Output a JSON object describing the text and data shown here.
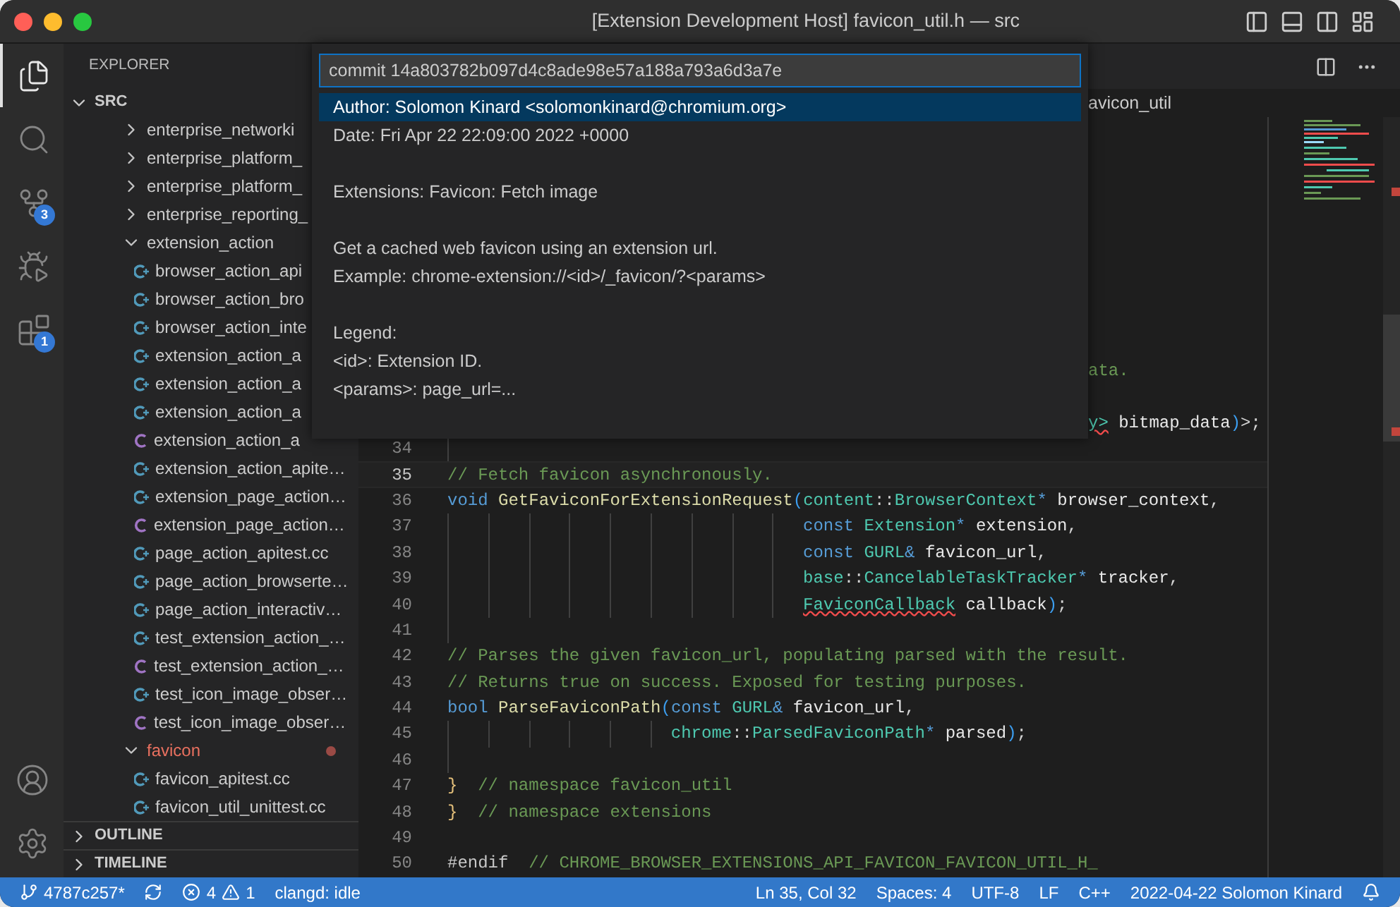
{
  "window": {
    "title": "[Extension Development Host] favicon_util.h — src"
  },
  "activity_bar": {
    "items": [
      {
        "kind": "explorer",
        "selected": true
      },
      {
        "kind": "search",
        "selected": false
      },
      {
        "kind": "source_control",
        "selected": false,
        "badge": "3"
      },
      {
        "kind": "run_debug",
        "selected": false
      },
      {
        "kind": "extensions",
        "selected": false,
        "badge": "1"
      }
    ],
    "bottom": [
      {
        "kind": "account"
      },
      {
        "kind": "settings"
      }
    ]
  },
  "sidebar": {
    "title": "EXPLORER",
    "root": {
      "label": "SRC",
      "expanded": true,
      "children": [
        {
          "label": "enterprise_networki",
          "kind": "folder",
          "expanded": false,
          "has_problems": false
        },
        {
          "label": "enterprise_platform_",
          "kind": "folder",
          "expanded": false,
          "has_problems": false
        },
        {
          "label": "enterprise_platform_",
          "kind": "folder",
          "expanded": false,
          "has_problems": false
        },
        {
          "label": "enterprise_reporting_",
          "kind": "folder",
          "expanded": false,
          "has_problems": false
        },
        {
          "label": "extension_action",
          "kind": "folder",
          "expanded": true,
          "has_problems": false,
          "children": [
            {
              "label": "browser_action_api",
              "kind": "source"
            },
            {
              "label": "browser_action_bro",
              "kind": "source"
            },
            {
              "label": "browser_action_inte",
              "kind": "source"
            },
            {
              "label": "extension_action_a",
              "kind": "source"
            },
            {
              "label": "extension_action_a",
              "kind": "source"
            },
            {
              "label": "extension_action_a",
              "kind": "source"
            },
            {
              "label": "extension_action_a",
              "kind": "header"
            },
            {
              "label": "extension_action_apite…",
              "kind": "source"
            },
            {
              "label": "extension_page_action…",
              "kind": "source"
            },
            {
              "label": "extension_page_action…",
              "kind": "header"
            },
            {
              "label": "page_action_apitest.cc",
              "kind": "source"
            },
            {
              "label": "page_action_browserte…",
              "kind": "source"
            },
            {
              "label": "page_action_interactiv…",
              "kind": "source"
            },
            {
              "label": "test_extension_action_…",
              "kind": "source"
            },
            {
              "label": "test_extension_action_…",
              "kind": "header"
            },
            {
              "label": "test_icon_image_obser…",
              "kind": "source"
            },
            {
              "label": "test_icon_image_obser…",
              "kind": "header"
            }
          ]
        },
        {
          "label": "favicon",
          "kind": "folder",
          "expanded": true,
          "has_problems": true,
          "children": [
            {
              "label": "favicon_apitest.cc",
              "kind": "source"
            },
            {
              "label": "favicon_util_unittest.cc",
              "kind": "source"
            }
          ]
        }
      ]
    },
    "sections": [
      {
        "label": "OUTLINE",
        "expanded": false
      },
      {
        "label": "TIMELINE",
        "expanded": false
      }
    ]
  },
  "editor": {
    "breadcrumb": "avicon_util",
    "covered_fragments": [
      {
        "tokens": [
          {
            "t": "ata.",
            "kind": "comment"
          }
        ]
      },
      {
        "tokens": [
          {
            "t": "y>",
            "kind": "type",
            "error": true
          },
          {
            "t": " bitmap_data",
            "kind": "param"
          },
          {
            "t": ")",
            "kind": "bracket"
          },
          {
            "t": ">;",
            "kind": "plain"
          }
        ]
      }
    ],
    "lines": [
      {
        "number": "34",
        "kind": "blank",
        "current": false
      },
      {
        "number": "35",
        "kind": "code",
        "current": true,
        "tokens": [
          {
            "t": "// Fetch favicon asynchronously.",
            "kind": "comment"
          }
        ]
      },
      {
        "number": "36",
        "kind": "code",
        "current": false,
        "tokens": [
          {
            "t": "void ",
            "kind": "keyword"
          },
          {
            "t": "GetFaviconForExtensionRequest",
            "kind": "function"
          },
          {
            "t": "(",
            "kind": "bracket"
          },
          {
            "t": "content",
            "kind": "type"
          },
          {
            "t": "::",
            "kind": "plain"
          },
          {
            "t": "BrowserContext",
            "kind": "type"
          },
          {
            "t": "* ",
            "kind": "keyword"
          },
          {
            "t": "browser_context",
            "kind": "param"
          },
          {
            "t": ",",
            "kind": "plain"
          }
        ]
      },
      {
        "number": "37",
        "kind": "continuation",
        "current": false,
        "tokens": [
          {
            "t": "const ",
            "kind": "keyword"
          },
          {
            "t": "Extension",
            "kind": "type"
          },
          {
            "t": "* ",
            "kind": "keyword"
          },
          {
            "t": "extension",
            "kind": "param"
          },
          {
            "t": ",",
            "kind": "plain"
          }
        ]
      },
      {
        "number": "38",
        "kind": "continuation",
        "current": false,
        "tokens": [
          {
            "t": "const ",
            "kind": "keyword"
          },
          {
            "t": "GURL",
            "kind": "type"
          },
          {
            "t": "& ",
            "kind": "keyword"
          },
          {
            "t": "favicon_url",
            "kind": "param"
          },
          {
            "t": ",",
            "kind": "plain"
          }
        ]
      },
      {
        "number": "39",
        "kind": "continuation",
        "current": false,
        "tokens": [
          {
            "t": "base",
            "kind": "type"
          },
          {
            "t": "::",
            "kind": "plain"
          },
          {
            "t": "CancelableTaskTracker",
            "kind": "type"
          },
          {
            "t": "* ",
            "kind": "keyword"
          },
          {
            "t": "tracker",
            "kind": "param"
          },
          {
            "t": ",",
            "kind": "plain"
          }
        ]
      },
      {
        "number": "40",
        "kind": "continuation",
        "current": false,
        "tokens": [
          {
            "t": "FaviconCallback",
            "kind": "type",
            "error": true
          },
          {
            "t": " callback",
            "kind": "param"
          },
          {
            "t": ")",
            "kind": "bracket"
          },
          {
            "t": ";",
            "kind": "plain"
          }
        ]
      },
      {
        "number": "41",
        "kind": "blank",
        "current": false
      },
      {
        "number": "42",
        "kind": "code",
        "current": false,
        "tokens": [
          {
            "t": "// Parses the given favicon_url, populating parsed with the result.",
            "kind": "comment"
          }
        ]
      },
      {
        "number": "43",
        "kind": "code",
        "current": false,
        "tokens": [
          {
            "t": "// Returns true on success. Exposed for testing purposes.",
            "kind": "comment"
          }
        ]
      },
      {
        "number": "44",
        "kind": "code",
        "current": false,
        "tokens": [
          {
            "t": "bool ",
            "kind": "keyword"
          },
          {
            "t": "ParseFaviconPath",
            "kind": "function"
          },
          {
            "t": "(",
            "kind": "bracket"
          },
          {
            "t": "const ",
            "kind": "keyword"
          },
          {
            "t": "GURL",
            "kind": "type"
          },
          {
            "t": "& ",
            "kind": "keyword"
          },
          {
            "t": "favicon_url",
            "kind": "param"
          },
          {
            "t": ",",
            "kind": "plain"
          }
        ]
      },
      {
        "number": "45",
        "kind": "continuation",
        "current": false,
        "tokens": [
          {
            "t": "chrome",
            "kind": "type"
          },
          {
            "t": "::",
            "kind": "plain"
          },
          {
            "t": "ParsedFaviconPath",
            "kind": "type"
          },
          {
            "t": "* ",
            "kind": "keyword"
          },
          {
            "t": "parsed",
            "kind": "param"
          },
          {
            "t": ")",
            "kind": "bracket"
          },
          {
            "t": ";",
            "kind": "plain"
          }
        ]
      },
      {
        "number": "46",
        "kind": "blank",
        "current": false
      },
      {
        "number": "47",
        "kind": "code",
        "current": false,
        "tokens": [
          {
            "t": "}  ",
            "kind": "brace"
          },
          {
            "t": "// namespace favicon_util",
            "kind": "comment"
          }
        ]
      },
      {
        "number": "48",
        "kind": "code",
        "current": false,
        "tokens": [
          {
            "t": "}  ",
            "kind": "brace"
          },
          {
            "t": "// namespace extensions",
            "kind": "comment"
          }
        ]
      },
      {
        "number": "49",
        "kind": "empty",
        "current": false
      },
      {
        "number": "50",
        "kind": "code",
        "current": false,
        "tokens": [
          {
            "t": "#endif  ",
            "kind": "macro"
          },
          {
            "t": "// CHROME_BROWSER_EXTENSIONS_API_FAVICON_FAVICON_UTIL_H_",
            "kind": "comment"
          }
        ]
      }
    ]
  },
  "quick_pick": {
    "value": "commit 14a803782b097d4c8ade98e57a188a793a6d3a7e",
    "items": [
      {
        "kind": "line",
        "text": "Author: Solomon Kinard <solomonkinard@chromium.org>",
        "selected": true
      },
      {
        "kind": "line",
        "text": "Date: Fri Apr 22 22:09:00 2022 +0000",
        "selected": false
      },
      {
        "kind": "blank"
      },
      {
        "kind": "line",
        "text": "Extensions: Favicon: Fetch image",
        "selected": false
      },
      {
        "kind": "blank"
      },
      {
        "kind": "line",
        "text": "Get a cached web favicon using an extension url.",
        "selected": false
      },
      {
        "kind": "line",
        "text": "Example: chrome-extension://<id>/_favicon/?<params>",
        "selected": false
      },
      {
        "kind": "blank"
      },
      {
        "kind": "line",
        "text": "Legend:",
        "selected": false
      },
      {
        "kind": "line",
        "text": "<id>: Extension ID.",
        "selected": false
      },
      {
        "kind": "line",
        "text": "<params>: page_url=...",
        "selected": false
      }
    ]
  },
  "status_bar": {
    "branch": "4787c257*",
    "errors": "4",
    "warnings": "1",
    "language_server": "clangd: idle",
    "right": [
      "Ln 35, Col 32",
      "Spaces: 4",
      "UTF-8",
      "LF",
      "C++",
      "2022-04-22 Solomon Kinard"
    ]
  }
}
